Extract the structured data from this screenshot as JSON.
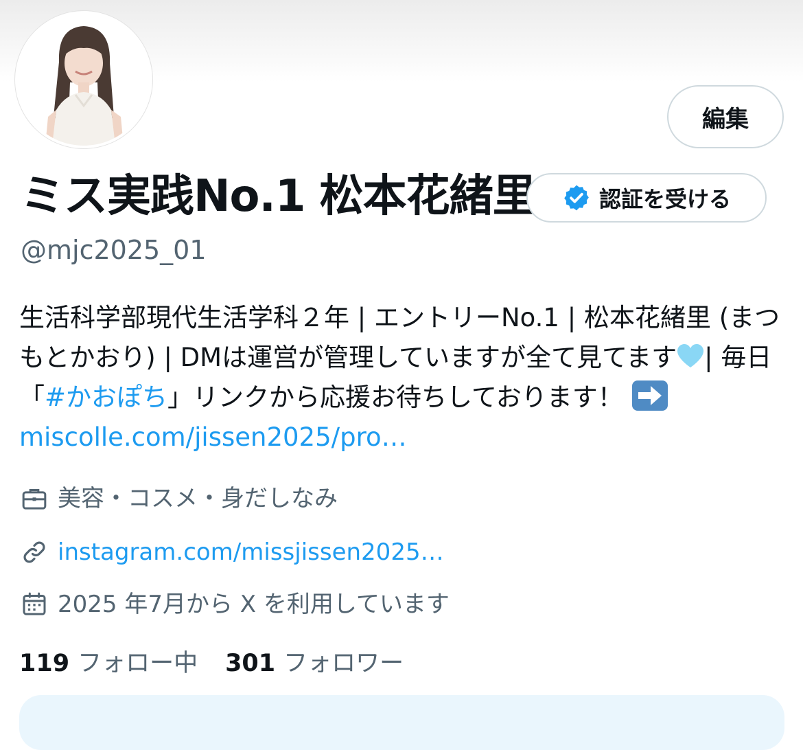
{
  "profile": {
    "display_name": "ミス実践No.1 松本花緒里",
    "handle": "@mjc2025_01",
    "edit_label": "編集",
    "verify_label": "認証を受ける",
    "avatar_icon": "profile-photo"
  },
  "bio": {
    "text_1": "生活科学部現代生活学科２年 | エントリーNo.1 | 松本花緒里 (まつもとかおり) | DMは運営が管理していますが全て見てます",
    "text_2": "| 毎日「",
    "hashtag": "#かおぽち",
    "text_3": "」リンクから応援お待ちしております！",
    "link": "miscolle.com/jissen2025/pro…",
    "heart_emoji": "light-blue-heart",
    "arrow_emoji": "right-arrow"
  },
  "meta": {
    "category": "美容・コスメ・身だしなみ",
    "category_icon": "briefcase-icon",
    "website": "instagram.com/missjissen2025…",
    "website_icon": "link-icon",
    "joined": "2025 年7月から X を利用しています",
    "joined_icon": "calendar-icon"
  },
  "stats": {
    "following_count": "119",
    "following_label": "フォロー中",
    "followers_count": "301",
    "followers_label": "フォロワー"
  },
  "colors": {
    "link": "#1d9bf0",
    "secondary_text": "#536471",
    "border": "#cfd9de",
    "verified_badge": "#1d9bf0"
  }
}
